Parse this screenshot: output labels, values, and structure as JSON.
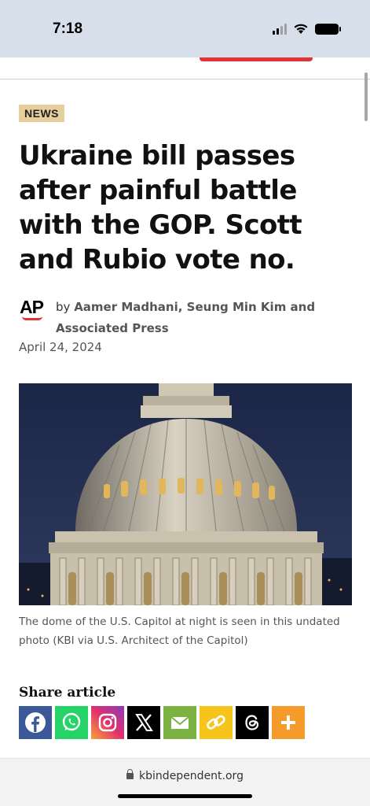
{
  "status_bar": {
    "time": "7:18",
    "icons": [
      "cellular-signal-icon",
      "wifi-icon",
      "battery-icon"
    ]
  },
  "article": {
    "category": "NEWS",
    "headline": "Ukraine bill passes after painful battle with the GOP. Scott and Rubio vote no.",
    "byline_prefix": "by",
    "authors": "Aamer Madhani, Seung Min Kim and Associated Press",
    "source_logo_text": "AP",
    "date": "April 24, 2024",
    "image_alt": "U.S. Capitol dome at night",
    "caption": "The dome of the U.S. Capitol at night is seen in this undated photo (KBI via U.S. Architect of the Capitol)"
  },
  "share": {
    "title": "Share article",
    "buttons": [
      {
        "name": "facebook",
        "color": "#3b5998",
        "icon": "facebook-icon"
      },
      {
        "name": "whatsapp",
        "color": "#25d366",
        "icon": "whatsapp-icon"
      },
      {
        "name": "instagram",
        "color": "#c13584",
        "icon": "instagram-icon"
      },
      {
        "name": "x",
        "color": "#000000",
        "icon": "x-icon"
      },
      {
        "name": "email",
        "color": "#7bb241",
        "icon": "email-icon"
      },
      {
        "name": "copy-link",
        "color": "#f6c41b",
        "icon": "link-icon"
      },
      {
        "name": "threads",
        "color": "#000000",
        "icon": "threads-icon"
      },
      {
        "name": "more",
        "color": "#f59b2b",
        "icon": "plus-icon"
      }
    ]
  },
  "browser": {
    "url": "kbindependent.org"
  },
  "colors": {
    "status_bar_bg": "#d7e0ea",
    "badge_bg": "#e6cf9c",
    "accent_red": "#e1323a"
  }
}
